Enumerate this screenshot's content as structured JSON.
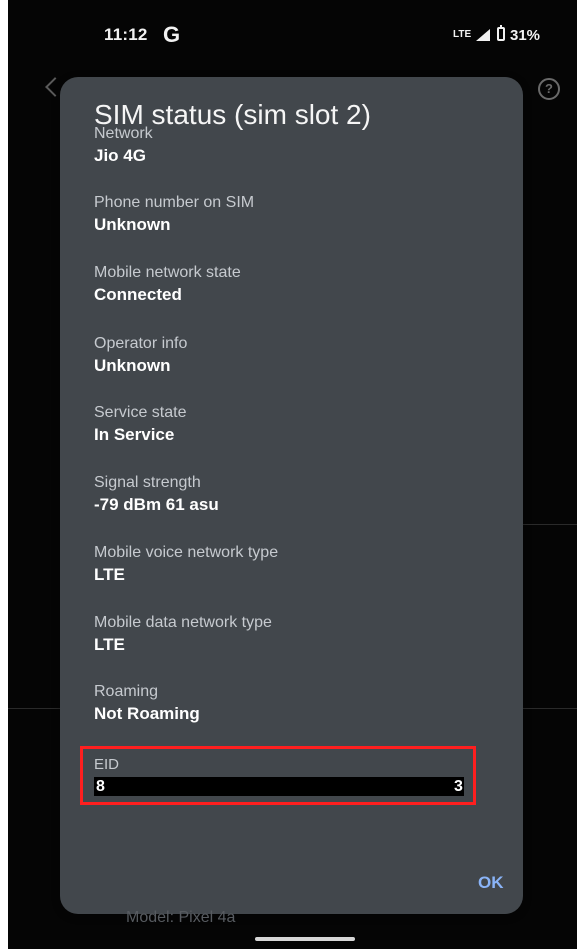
{
  "status_bar": {
    "time": "11:12",
    "app_icon": "G",
    "network_type": "LTE",
    "battery": "31%",
    "icons": [
      "google-icon",
      "signal-icon",
      "battery-icon"
    ]
  },
  "background": {
    "help_icon": "?",
    "model_text": "Model: Pixel 4a"
  },
  "dialog": {
    "title": "SIM status (sim slot 2)",
    "fields": [
      {
        "label": "Network",
        "value": "Jio 4G"
      },
      {
        "label": "Phone number on SIM",
        "value": "Unknown"
      },
      {
        "label": "Mobile network state",
        "value": "Connected"
      },
      {
        "label": "Operator info",
        "value": "Unknown"
      },
      {
        "label": "Service state",
        "value": "In Service"
      },
      {
        "label": "Signal strength",
        "value": "-79 dBm 61 asu"
      },
      {
        "label": "Mobile voice network type",
        "value": "LTE"
      },
      {
        "label": "Mobile data network type",
        "value": "LTE"
      },
      {
        "label": "Roaming",
        "value": "Not Roaming"
      }
    ],
    "eid": {
      "label": "EID",
      "prefix": "8",
      "suffix": "3"
    },
    "ok_label": "OK"
  },
  "colors": {
    "background": "#050505",
    "dialog": "#42474c",
    "highlight": "#ff1f1f",
    "accent": "#8ab4f8"
  }
}
